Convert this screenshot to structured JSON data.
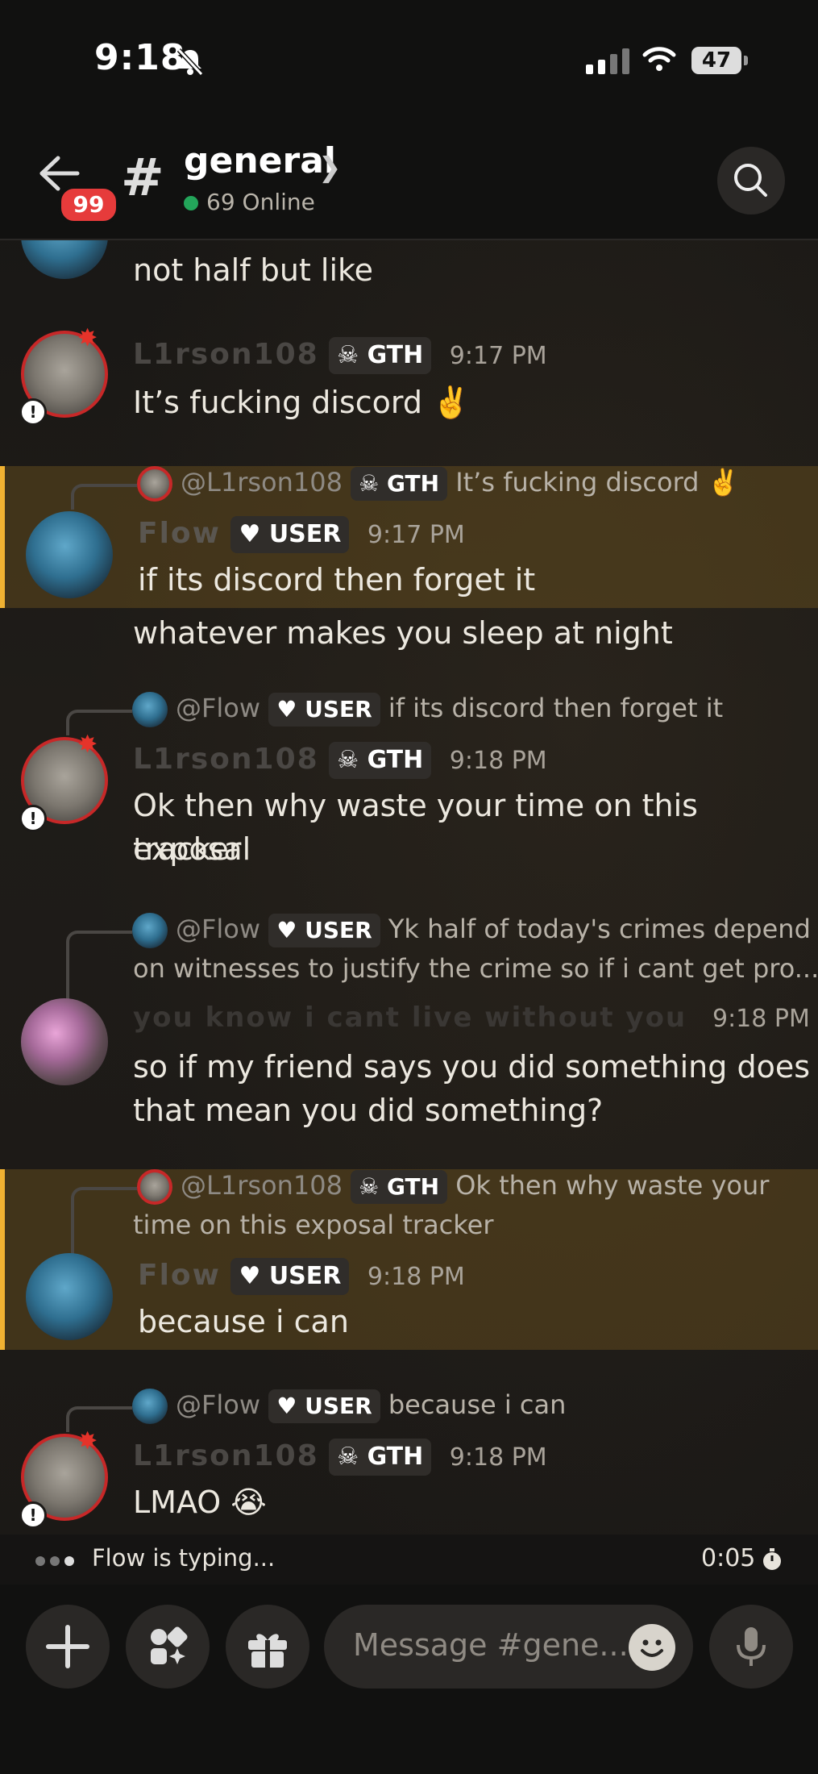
{
  "status_bar": {
    "time": "9:18",
    "battery": "47"
  },
  "header": {
    "channel": "general",
    "online": "69 Online",
    "badge": "99",
    "hash": "#"
  },
  "messages": [
    {
      "body": "not half but like"
    },
    {
      "name": "L1rson108",
      "tag": "GTH",
      "time": "9:17 PM",
      "body": "It’s fucking discord ✌️"
    },
    {
      "reply_mention": "@L1rson108",
      "reply_tag": "GTH",
      "reply_text": "It’s fucking discord ✌️",
      "name": "Flow",
      "tag": "USER",
      "time": "9:17 PM",
      "body": "if its discord then forget it",
      "body2": "whatever makes you sleep at night"
    },
    {
      "reply_mention": "@Flow",
      "reply_tag": "USER",
      "reply_text": "if its discord then forget it",
      "name": "L1rson108",
      "tag": "GTH",
      "time": "9:18 PM",
      "body": "Ok then why waste your time on this exposal",
      "body2": "tracker"
    },
    {
      "reply_mention": "@Flow",
      "reply_tag": "USER",
      "reply_text": "Yk half of today's crimes depend",
      "reply_text2": "on witnesses to justify the crime so if i cant get pro...",
      "name": "you know i cant live without you",
      "time": "9:18 PM",
      "body": "so if my friend says you did something does",
      "body2": "that mean you did something?"
    },
    {
      "reply_mention": "@L1rson108",
      "reply_tag": "GTH",
      "reply_text": "Ok then why waste your",
      "reply_text2": "time on this exposal tracker",
      "name": "Flow",
      "tag": "USER",
      "time": "9:18 PM",
      "body": "because i can"
    },
    {
      "reply_mention": "@Flow",
      "reply_tag": "USER",
      "reply_text": "because i can",
      "name": "L1rson108",
      "tag": "GTH",
      "time": "9:18 PM",
      "body": "LMAO 😭"
    }
  ],
  "typing": {
    "text": "Flow is typing...",
    "timer": "0:05"
  },
  "composer": {
    "placeholder": "Message #gene..."
  },
  "icons": {
    "back": "arrow-left-icon",
    "search": "search-icon",
    "add": "plus-icon",
    "apps": "apps-icon",
    "gift": "gift-icon",
    "emoji": "emoji-icon",
    "mic": "microphone-icon"
  },
  "colors": {
    "accent_yellow": "#f0b232",
    "online_green": "#23a55a",
    "badge_red": "#e63b3b"
  }
}
